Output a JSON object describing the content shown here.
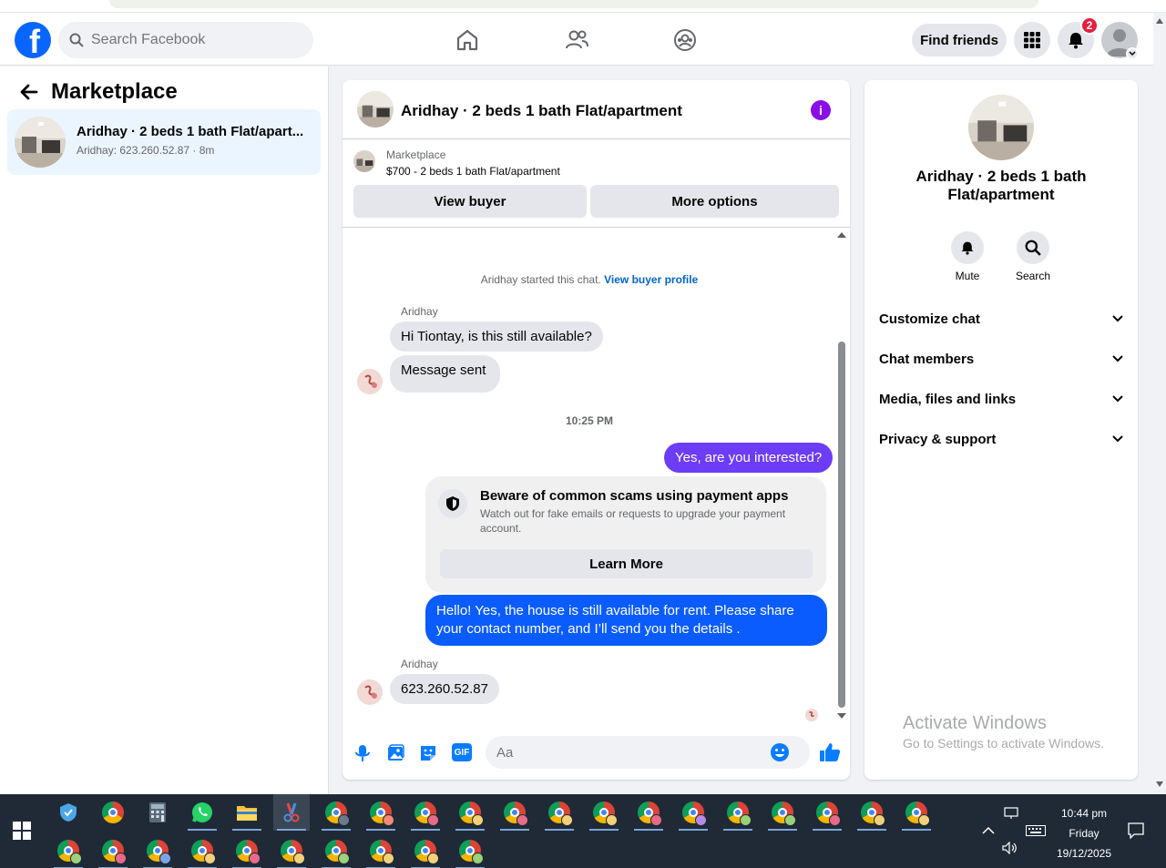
{
  "header": {
    "search_placeholder": "Search Facebook",
    "find_friends": "Find friends",
    "notification_count": "2",
    "brand_color": "#0866ff"
  },
  "sidebar": {
    "title": "Marketplace",
    "thread": {
      "title": "Aridhay · 2 beds 1 bath Flat/apart...",
      "subtitle": "Aridhay: 623.260.52.87 · 8m"
    }
  },
  "chat": {
    "title": "Aridhay · 2 beds 1 bath Flat/apartment",
    "listing": {
      "category": "Marketplace",
      "price_line": "$700 - 2 beds 1 bath Flat/apartment"
    },
    "view_buyer": "View buyer",
    "more_options": "More options",
    "system_text": "Aridhay started this chat.",
    "system_link": "View buyer profile",
    "sender1": "Aridhay",
    "msg1": "Hi Tiontay, is this still available?",
    "msg2": "Message sent",
    "time_sep": "10:25 PM",
    "out1": "Yes, are you interested?",
    "scam": {
      "title": "Beware of common scams using payment apps",
      "desc": "Watch out for fake emails or requests to upgrade your payment account.",
      "button": "Learn More"
    },
    "out2": "Hello! Yes, the house is still available for rent. Please share your contact number, and I’ll send you the details .",
    "sender2": "Aridhay",
    "msg3": "623.260.52.87",
    "composer_placeholder": "Aa",
    "gif_label": "GIF"
  },
  "info": {
    "title": "Aridhay · 2 beds 1 bath Flat/apartment",
    "mute": "Mute",
    "search": "Search",
    "sections": [
      "Customize chat",
      "Chat members",
      "Media, files and links",
      "Privacy & support"
    ]
  },
  "watermark": {
    "line1": "Activate Windows",
    "line2": "Go to Settings to activate Windows."
  },
  "taskbar": {
    "time": "10:44 pm",
    "day": "Friday",
    "date": "19/12/2025"
  }
}
